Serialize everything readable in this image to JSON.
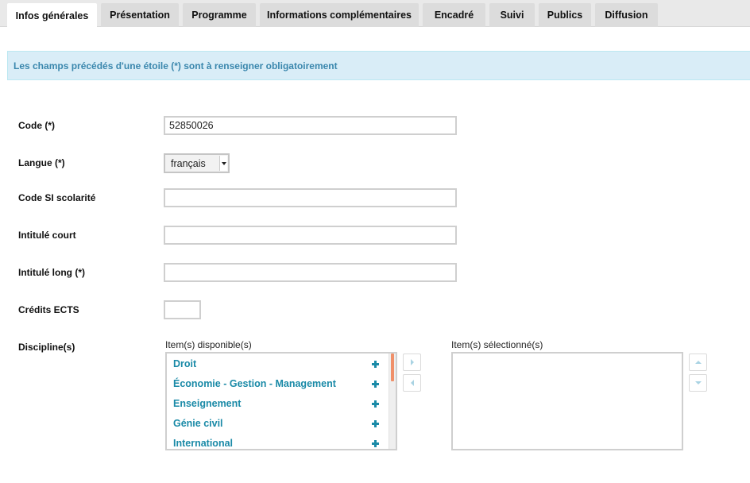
{
  "tabs": [
    {
      "label": "Infos générales",
      "active": true
    },
    {
      "label": "Présentation"
    },
    {
      "label": "Programme"
    },
    {
      "label": "Informations complémentaires"
    },
    {
      "label": "Encadré"
    },
    {
      "label": "Suivi"
    },
    {
      "label": "Publics"
    },
    {
      "label": "Diffusion"
    }
  ],
  "banner": {
    "text": "Les champs précédés d'une étoile (*) sont à renseigner obligatoirement"
  },
  "form": {
    "code": {
      "label": "Code (*)",
      "value": "52850026"
    },
    "langue": {
      "label": "Langue  (*)",
      "selected": "français"
    },
    "code_si": {
      "label": "Code SI scolarité",
      "value": ""
    },
    "intitule_court": {
      "label": "Intitulé court",
      "value": ""
    },
    "intitule_long": {
      "label": "Intitulé long (*)",
      "value": ""
    },
    "credits": {
      "label": "Crédits ECTS",
      "value": ""
    },
    "discipline": {
      "label": "Discipline(s)",
      "available_title": "Item(s) disponible(s)",
      "selected_title": "Item(s) sélectionné(s)",
      "available_items": [
        {
          "label": "Droit"
        },
        {
          "label": "Économie - Gestion - Management"
        },
        {
          "label": "Enseignement"
        },
        {
          "label": "Génie civil"
        },
        {
          "label": "International"
        }
      ],
      "selected_items": []
    }
  },
  "icons": {
    "add": "plus-icon",
    "move_right": "arrow-right-icon",
    "move_left": "arrow-left-icon",
    "move_up": "arrow-up-icon",
    "move_down": "arrow-down-icon",
    "dropdown": "chevron-down-icon"
  },
  "colors": {
    "banner_bg": "#d9edf7",
    "banner_text": "#3a87ad",
    "link": "#1a8aa7",
    "scroll_thumb": "#f0906a"
  }
}
